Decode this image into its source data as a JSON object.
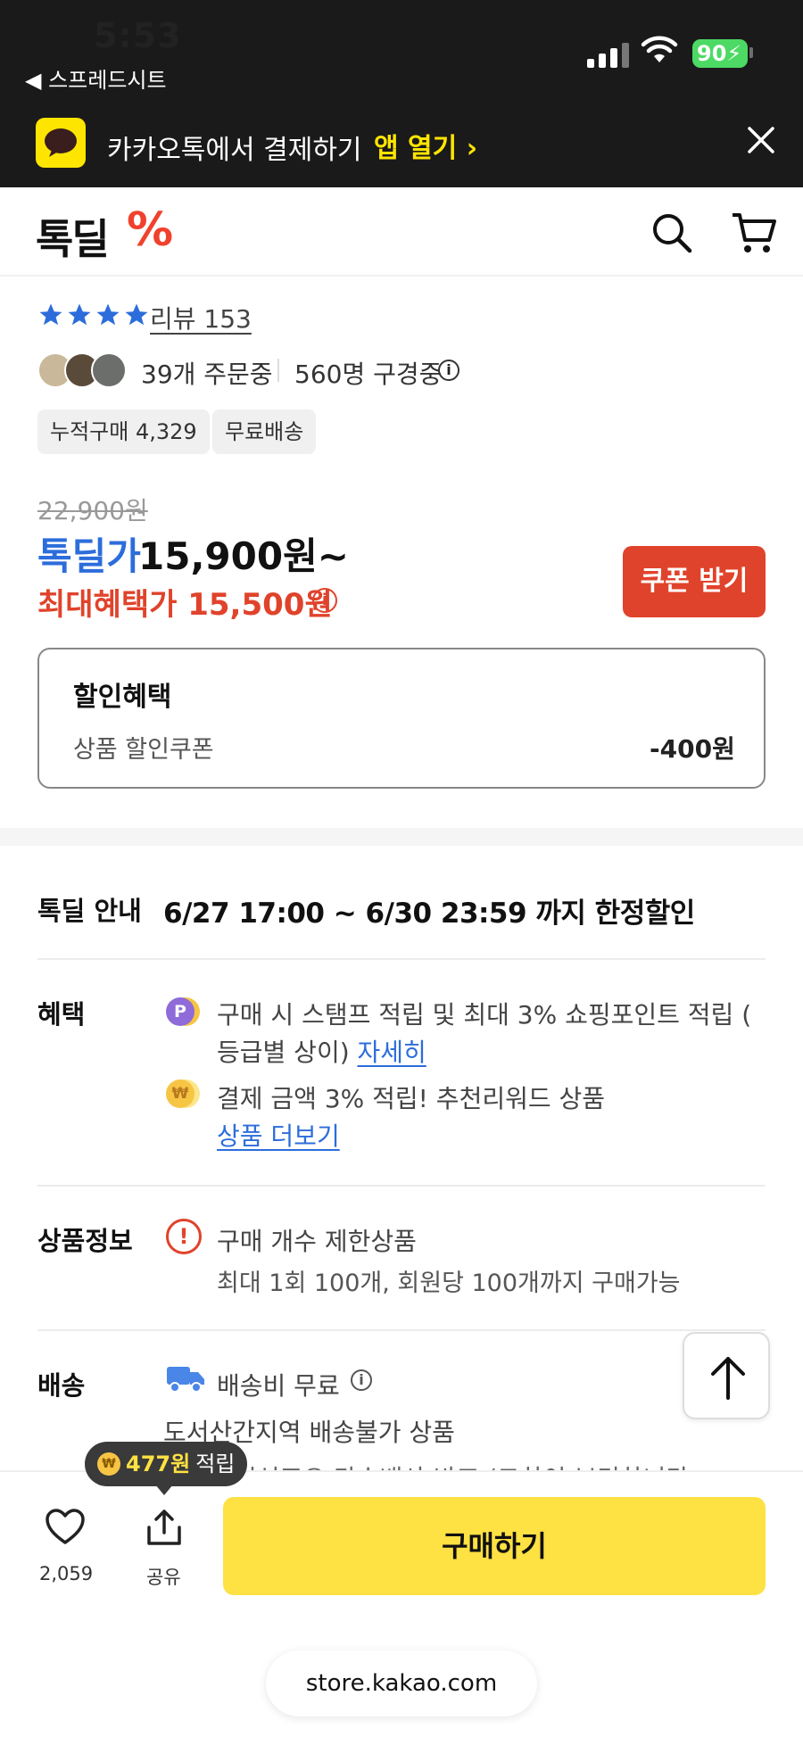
{
  "status_bar": {
    "time": "5:53",
    "back_label": "◀ 스프레드시트",
    "battery": "90"
  },
  "banner": {
    "text": "카카오톡에서 결제하기",
    "link": "앱 열기 ›"
  },
  "header": {
    "logo_text": "톡딜",
    "logo_mark": "%"
  },
  "product": {
    "review_label": "리뷰 153",
    "rating_stars": 4,
    "orders": "39개 주문중",
    "viewers": "560명 구경중",
    "tags": [
      "누적구매 4,329",
      "무료배송"
    ],
    "original_price": "22,900원",
    "deal_label": "톡딜가",
    "deal_price": "15,900원~",
    "max_benefit": "최대혜택가 15,500원",
    "coupon_button": "쿠폰 받기",
    "discount": {
      "title": "할인혜택",
      "item": "상품 할인쿠폰",
      "amount": "-400원"
    }
  },
  "details": {
    "deal_info": {
      "label": "톡딜 안내",
      "text": "6/27 17:00 ~ 6/30 23:59 까지 한정할인"
    },
    "benefit": {
      "label": "혜택",
      "line1": "구매 시 스탬프 적립 및 최대 3% 쇼핑포인트 적립 (",
      "line2_prefix": "등급별 상이) ",
      "line2_link": "자세히",
      "line3": "결제 금액 3% 적립! 추천리워드 상품",
      "line4_link": "상품 더보기",
      "icon_p": "P",
      "icon_w": "₩"
    },
    "product_info": {
      "label": "상품정보",
      "line1": "구매 개수 제한상품",
      "line2": "최대 1회 100개, 회원당 100개까지 구매가능"
    },
    "shipping": {
      "label": "배송",
      "line1": "배송비 무료",
      "line2": "도서산간지역 배송불가 상품",
      "line3": "시선표오 다수배사 바프 (그하이 보리하니다"
    }
  },
  "bottom_bar": {
    "like_count": "2,059",
    "share_label": "공유",
    "buy_button": "구매하기",
    "tooltip_amount": "477원",
    "tooltip_suffix": "적립"
  },
  "browser": {
    "url": "store.kakao.com"
  }
}
